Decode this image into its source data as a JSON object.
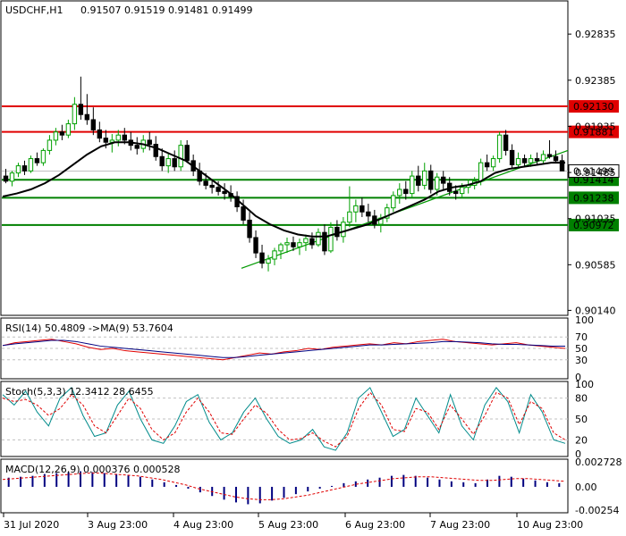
{
  "header": {
    "symbol": "USDCHF,H1",
    "ohlc": "0.91507 0.91519 0.91481 0.91499"
  },
  "colors": {
    "bull": "#00a000",
    "bear": "#000000",
    "ma": "#000000",
    "resistance": "#e00000",
    "support": "#008000",
    "trend": "#009900",
    "rsi": "#e00000",
    "rsi_ma": "#000080",
    "stoch_main": "#008b8b",
    "stoch_signal": "#e00000",
    "macd_hist": "#000080",
    "macd_signal": "#e00000"
  },
  "price_panel": {
    "levels": [
      {
        "label": "0.92835",
        "value": 0.92835
      },
      {
        "label": "0.92385",
        "value": 0.92385
      },
      {
        "label": "0.91935",
        "value": 0.91935
      },
      {
        "label": "0.91485",
        "value": 0.91485
      },
      {
        "label": "0.91035",
        "value": 0.91035
      },
      {
        "label": "0.90585",
        "value": 0.90585
      },
      {
        "label": "0.90140",
        "value": 0.9014
      }
    ],
    "hlines": [
      {
        "label": "0.92130",
        "value": 0.9213,
        "kind": "resistance"
      },
      {
        "label": "0.91881",
        "value": 0.91881,
        "kind": "resistance"
      },
      {
        "label": "0.91414",
        "value": 0.91414,
        "kind": "support"
      },
      {
        "label": "0.91238",
        "value": 0.91238,
        "kind": "support"
      },
      {
        "label": "0.90972",
        "value": 0.90972,
        "kind": "support"
      }
    ],
    "current_price": "0.91499"
  },
  "rsi_panel": {
    "title": "RSI(14) 50.4809   ->MA(9) 53.7604",
    "ticks": [
      "100",
      "70",
      "50",
      "30",
      "0"
    ]
  },
  "stoch_panel": {
    "title": "Stoch(5,3,3) 12.3412 28.6455",
    "ticks": [
      "100",
      "80",
      "50",
      "20",
      "0"
    ]
  },
  "macd_panel": {
    "title": "MACD(12,26,9) 0.000376 0.000528",
    "ticks": [
      "0.002728",
      "0.00",
      "-0.00254"
    ]
  },
  "x_axis": {
    "labels": [
      "31 Jul 2020",
      "3 Aug 23:00",
      "4 Aug 23:00",
      "5 Aug 23:00",
      "6 Aug 23:00",
      "7 Aug 23:00",
      "10 Aug 23:00"
    ]
  },
  "chart_data": {
    "type": "candlestick",
    "symbol": "USDCHF",
    "timeframe": "H1",
    "price_range": [
      0.901,
      0.9315
    ],
    "candles": [
      [
        0.9145,
        0.9152,
        0.9138,
        0.914
      ],
      [
        0.914,
        0.915,
        0.9135,
        0.9148
      ],
      [
        0.9148,
        0.9158,
        0.9144,
        0.9155
      ],
      [
        0.9155,
        0.916,
        0.9146,
        0.915
      ],
      [
        0.915,
        0.9165,
        0.9148,
        0.9162
      ],
      [
        0.9162,
        0.9168,
        0.9155,
        0.9158
      ],
      [
        0.9158,
        0.9172,
        0.9155,
        0.917
      ],
      [
        0.917,
        0.9185,
        0.9166,
        0.918
      ],
      [
        0.918,
        0.9192,
        0.9175,
        0.9188
      ],
      [
        0.9188,
        0.9195,
        0.918,
        0.9185
      ],
      [
        0.9185,
        0.92,
        0.9182,
        0.9196
      ],
      [
        0.9196,
        0.9222,
        0.919,
        0.9215
      ],
      [
        0.9215,
        0.9242,
        0.92,
        0.9205
      ],
      [
        0.9205,
        0.9225,
        0.9195,
        0.92
      ],
      [
        0.92,
        0.9212,
        0.9185,
        0.919
      ],
      [
        0.919,
        0.9198,
        0.9178,
        0.9182
      ],
      [
        0.9182,
        0.919,
        0.9172,
        0.9178
      ],
      [
        0.9178,
        0.9186,
        0.9168,
        0.918
      ],
      [
        0.918,
        0.919,
        0.9174,
        0.9185
      ],
      [
        0.9185,
        0.9192,
        0.9176,
        0.918
      ],
      [
        0.918,
        0.9188,
        0.917,
        0.9175
      ],
      [
        0.9175,
        0.9183,
        0.9166,
        0.9172
      ],
      [
        0.9172,
        0.9185,
        0.9168,
        0.918
      ],
      [
        0.918,
        0.9188,
        0.917,
        0.9176
      ],
      [
        0.9176,
        0.9184,
        0.916,
        0.9164
      ],
      [
        0.9164,
        0.9172,
        0.915,
        0.9155
      ],
      [
        0.9155,
        0.9168,
        0.9148,
        0.9162
      ],
      [
        0.9162,
        0.917,
        0.915,
        0.9154
      ],
      [
        0.9154,
        0.918,
        0.915,
        0.9175
      ],
      [
        0.9175,
        0.918,
        0.9158,
        0.916
      ],
      [
        0.916,
        0.9166,
        0.9145,
        0.915
      ],
      [
        0.915,
        0.9158,
        0.9136,
        0.914
      ],
      [
        0.914,
        0.9148,
        0.9132,
        0.9136
      ],
      [
        0.9136,
        0.9142,
        0.9128,
        0.9134
      ],
      [
        0.9134,
        0.914,
        0.9126,
        0.913
      ],
      [
        0.913,
        0.9138,
        0.9122,
        0.9128
      ],
      [
        0.9128,
        0.9136,
        0.912,
        0.9125
      ],
      [
        0.9125,
        0.913,
        0.911,
        0.9115
      ],
      [
        0.9115,
        0.9122,
        0.9098,
        0.9102
      ],
      [
        0.9102,
        0.911,
        0.908,
        0.9085
      ],
      [
        0.9085,
        0.9092,
        0.9065,
        0.907
      ],
      [
        0.907,
        0.9078,
        0.9055,
        0.906
      ],
      [
        0.906,
        0.9068,
        0.9052,
        0.9064
      ],
      [
        0.9064,
        0.9075,
        0.9058,
        0.9072
      ],
      [
        0.9072,
        0.908,
        0.9064,
        0.9078
      ],
      [
        0.9078,
        0.9085,
        0.907,
        0.908
      ],
      [
        0.908,
        0.9086,
        0.9072,
        0.9076
      ],
      [
        0.9076,
        0.9084,
        0.9068,
        0.908
      ],
      [
        0.908,
        0.9088,
        0.9072,
        0.9084
      ],
      [
        0.9084,
        0.909,
        0.9074,
        0.9078
      ],
      [
        0.9078,
        0.9094,
        0.9076,
        0.909
      ],
      [
        0.909,
        0.9098,
        0.9068,
        0.9072
      ],
      [
        0.9072,
        0.91,
        0.907,
        0.9095
      ],
      [
        0.9095,
        0.9102,
        0.9082,
        0.9086
      ],
      [
        0.9086,
        0.9105,
        0.908,
        0.91
      ],
      [
        0.91,
        0.9135,
        0.9095,
        0.911
      ],
      [
        0.911,
        0.9122,
        0.91,
        0.9116
      ],
      [
        0.9116,
        0.9124,
        0.9105,
        0.911
      ],
      [
        0.911,
        0.9118,
        0.91,
        0.9106
      ],
      [
        0.9106,
        0.9112,
        0.9094,
        0.9098
      ],
      [
        0.9098,
        0.9108,
        0.909,
        0.9104
      ],
      [
        0.9104,
        0.9118,
        0.91,
        0.9114
      ],
      [
        0.9114,
        0.913,
        0.911,
        0.9126
      ],
      [
        0.9126,
        0.9138,
        0.9118,
        0.9132
      ],
      [
        0.9132,
        0.914,
        0.9122,
        0.9128
      ],
      [
        0.9128,
        0.915,
        0.9124,
        0.9145
      ],
      [
        0.9145,
        0.9155,
        0.913,
        0.9136
      ],
      [
        0.9136,
        0.9158,
        0.9132,
        0.915
      ],
      [
        0.915,
        0.9156,
        0.9128,
        0.9132
      ],
      [
        0.9132,
        0.9148,
        0.9126,
        0.9144
      ],
      [
        0.9144,
        0.915,
        0.9132,
        0.9138
      ],
      [
        0.9138,
        0.9144,
        0.9126,
        0.913
      ],
      [
        0.913,
        0.9136,
        0.9122,
        0.9128
      ],
      [
        0.9128,
        0.9138,
        0.9124,
        0.9134
      ],
      [
        0.9134,
        0.9142,
        0.9128,
        0.9136
      ],
      [
        0.9136,
        0.9144,
        0.9132,
        0.914
      ],
      [
        0.914,
        0.9162,
        0.9136,
        0.9158
      ],
      [
        0.9158,
        0.9166,
        0.915,
        0.9154
      ],
      [
        0.9154,
        0.9165,
        0.915,
        0.9162
      ],
      [
        0.9162,
        0.9188,
        0.9158,
        0.9185
      ],
      [
        0.9185,
        0.919,
        0.9165,
        0.917
      ],
      [
        0.917,
        0.9176,
        0.9152,
        0.9156
      ],
      [
        0.9156,
        0.9168,
        0.9152,
        0.9162
      ],
      [
        0.9162,
        0.9166,
        0.9154,
        0.9158
      ],
      [
        0.9158,
        0.9166,
        0.9154,
        0.9162
      ],
      [
        0.9162,
        0.9168,
        0.9156,
        0.916
      ],
      [
        0.916,
        0.917,
        0.9156,
        0.9166
      ],
      [
        0.9166,
        0.918,
        0.9162,
        0.9164
      ],
      [
        0.9164,
        0.917,
        0.9158,
        0.916
      ],
      [
        0.916,
        0.9166,
        0.915,
        0.915
      ]
    ],
    "ma_line": [
      0.9125,
      0.9128,
      0.9132,
      0.9138,
      0.9146,
      0.9156,
      0.9166,
      0.9174,
      0.9178,
      0.9178,
      0.9176,
      0.9172,
      0.9166,
      0.916,
      0.915,
      0.914,
      0.913,
      0.9118,
      0.9106,
      0.9098,
      0.9092,
      0.9088,
      0.9086,
      0.9086,
      0.909,
      0.9094,
      0.9098,
      0.9104,
      0.911,
      0.9116,
      0.9122,
      0.913,
      0.9134,
      0.9136,
      0.914,
      0.9148,
      0.9152,
      0.9154,
      0.9156,
      0.9158,
      0.9158
    ],
    "trend_line": [
      [
        0.9055,
        0
      ],
      [
        0.917,
        1
      ]
    ],
    "rsi": [
      55,
      60,
      62,
      64,
      66,
      62,
      58,
      52,
      48,
      50,
      46,
      44,
      42,
      40,
      38,
      36,
      34,
      32,
      30,
      34,
      38,
      42,
      40,
      44,
      46,
      50,
      48,
      52,
      54,
      56,
      58,
      56,
      60,
      58,
      62,
      64,
      66,
      62,
      60,
      58,
      56,
      58,
      60,
      56,
      54,
      52,
      50
    ],
    "rsi_ma": [
      55,
      58,
      60,
      62,
      64,
      64,
      62,
      58,
      54,
      52,
      50,
      48,
      46,
      44,
      42,
      40,
      38,
      36,
      34,
      34,
      36,
      38,
      40,
      42,
      44,
      46,
      48,
      50,
      52,
      54,
      56,
      56,
      57,
      58,
      59,
      60,
      62,
      62,
      61,
      60,
      58,
      57,
      57,
      56,
      55,
      54,
      54
    ],
    "stoch_main": [
      85,
      70,
      90,
      60,
      40,
      80,
      95,
      55,
      25,
      30,
      70,
      90,
      50,
      20,
      15,
      40,
      75,
      85,
      45,
      20,
      30,
      60,
      80,
      50,
      25,
      15,
      20,
      35,
      10,
      5,
      30,
      80,
      95,
      60,
      25,
      35,
      80,
      55,
      30,
      85,
      40,
      20,
      70,
      95,
      75,
      30,
      85,
      60,
      20,
      15
    ],
    "stoch_signal": [
      80,
      75,
      78,
      70,
      55,
      65,
      85,
      70,
      40,
      30,
      55,
      80,
      65,
      35,
      20,
      30,
      60,
      80,
      60,
      30,
      28,
      50,
      70,
      58,
      35,
      20,
      22,
      30,
      18,
      10,
      25,
      65,
      88,
      70,
      35,
      32,
      65,
      60,
      35,
      70,
      50,
      28,
      55,
      88,
      80,
      42,
      75,
      65,
      30,
      20
    ],
    "macd_hist": [
      0.001,
      0.0011,
      0.0012,
      0.0014,
      0.0015,
      0.0016,
      0.0017,
      0.0016,
      0.0015,
      0.0014,
      0.0013,
      0.0011,
      0.0008,
      0.0005,
      0.0002,
      -0.0002,
      -0.0006,
      -0.001,
      -0.0014,
      -0.0017,
      -0.0019,
      -0.0018,
      -0.0015,
      -0.0012,
      -0.0008,
      -0.0005,
      -0.0002,
      0.0001,
      0.0004,
      0.0006,
      0.0008,
      0.001,
      0.0012,
      0.0013,
      0.0012,
      0.001,
      0.0008,
      0.0006,
      0.0005,
      0.0004,
      0.0008,
      0.0012,
      0.0011,
      0.0009,
      0.0007,
      0.0005,
      0.0004
    ],
    "macd_signal": [
      0.0008,
      0.0009,
      0.001,
      0.0011,
      0.0012,
      0.0013,
      0.0014,
      0.0015,
      0.0015,
      0.0014,
      0.0013,
      0.0012,
      0.001,
      0.0008,
      0.0005,
      0.0002,
      -0.0002,
      -0.0005,
      -0.0008,
      -0.0011,
      -0.0013,
      -0.0014,
      -0.0014,
      -0.0013,
      -0.0011,
      -0.0009,
      -0.0006,
      -0.0003,
      0.0,
      0.0003,
      0.0005,
      0.0007,
      0.0009,
      0.001,
      0.0011,
      0.0011,
      0.001,
      0.0009,
      0.0008,
      0.0007,
      0.0007,
      0.0008,
      0.0009,
      0.0009,
      0.0008,
      0.0007,
      0.0006
    ],
    "rsi_range": [
      0,
      100
    ],
    "stoch_range": [
      0,
      100
    ],
    "macd_range": [
      -0.00254,
      0.002728
    ]
  }
}
